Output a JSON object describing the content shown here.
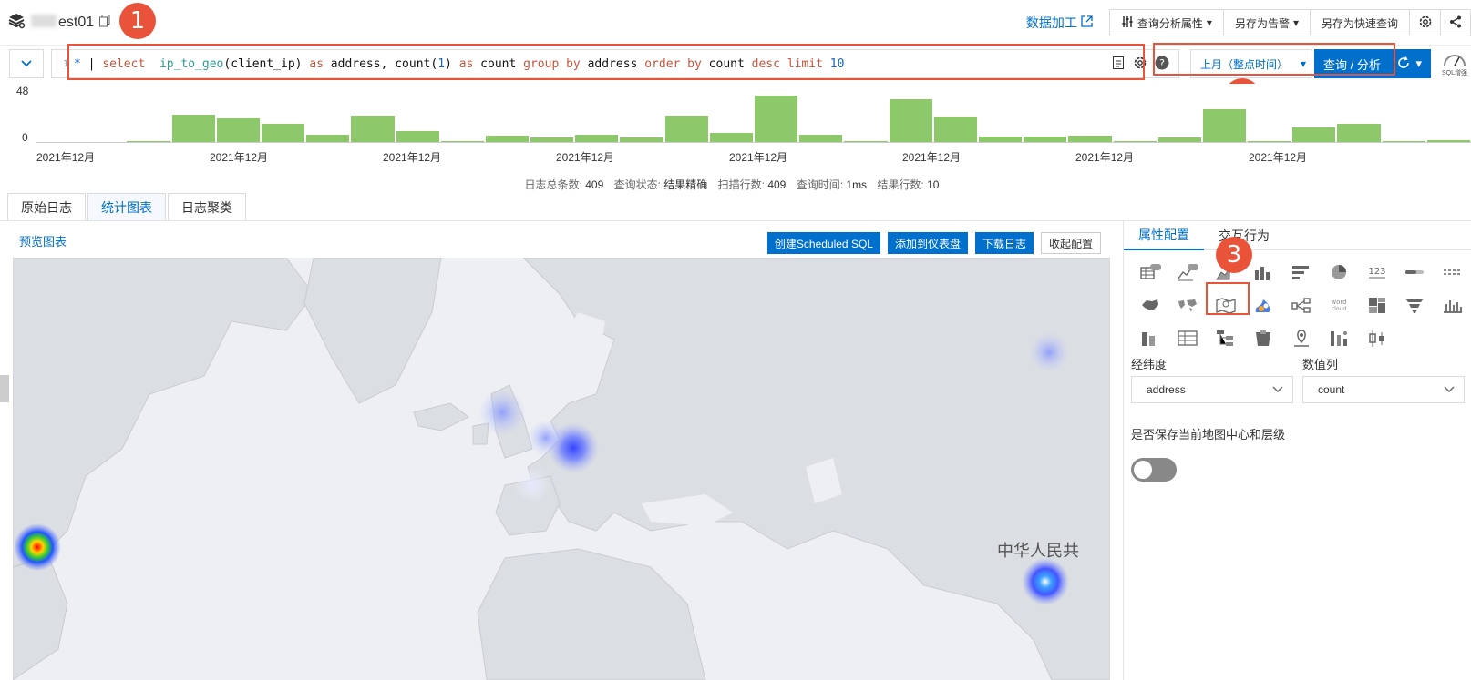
{
  "header": {
    "logstore_name": "est01",
    "data_processing_label": "数据加工",
    "buttons": [
      "查询分析属性",
      "另存为告警",
      "另存为快速查询"
    ]
  },
  "query": {
    "line_number": "1",
    "tokens": [
      {
        "t": "*",
        "c": "star"
      },
      {
        "t": " | ",
        "c": "plain"
      },
      {
        "t": "select",
        "c": "kw"
      },
      {
        "t": "  ",
        "c": "plain"
      },
      {
        "t": "ip_to_geo",
        "c": "fn"
      },
      {
        "t": "(client_ip) ",
        "c": "plain"
      },
      {
        "t": "as",
        "c": "kw"
      },
      {
        "t": " address, count(",
        "c": "plain"
      },
      {
        "t": "1",
        "c": "num"
      },
      {
        "t": ") ",
        "c": "plain"
      },
      {
        "t": "as",
        "c": "kw"
      },
      {
        "t": " count ",
        "c": "plain"
      },
      {
        "t": "group by",
        "c": "kw"
      },
      {
        "t": " address ",
        "c": "plain"
      },
      {
        "t": "order by",
        "c": "kw"
      },
      {
        "t": " count ",
        "c": "plain"
      },
      {
        "t": "desc limit",
        "c": "kw"
      },
      {
        "t": " ",
        "c": "plain"
      },
      {
        "t": "10",
        "c": "num"
      }
    ],
    "time_range": "上月（整点时间）",
    "run_label": "查询 / 分析",
    "sql_enhance_label": "SQL增强"
  },
  "annotations": [
    "1",
    "2",
    "3"
  ],
  "histogram": {
    "y_max": "48",
    "y_min": "0",
    "x_labels": [
      "2021年12月",
      "2021年12月",
      "2021年12月",
      "2021年12月",
      "2021年12月",
      "2021年12月",
      "2021年12月",
      "2021年12月"
    ],
    "values": [
      0,
      0,
      1,
      26,
      22,
      17,
      7,
      25,
      10,
      1,
      6,
      4,
      7,
      4,
      25,
      9,
      44,
      7,
      1,
      40,
      24,
      5,
      5,
      6,
      1,
      4,
      31,
      1,
      14,
      17,
      1,
      2
    ]
  },
  "stats": {
    "total_label": "日志总条数:",
    "total": "409",
    "status_label": "查询状态:",
    "status": "结果精确",
    "scanned_label": "扫描行数:",
    "scanned": "409",
    "time_label": "查询时间:",
    "time": "1ms",
    "rows_label": "结果行数:",
    "rows": "10"
  },
  "tabs": [
    "原始日志",
    "统计图表",
    "日志聚类"
  ],
  "left_pane": {
    "preview_title": "预览图表",
    "actions": [
      "创建Scheduled SQL",
      "添加到仪表盘",
      "下载日志",
      "收起配置"
    ],
    "map_label": "中华人民共"
  },
  "right_pane": {
    "tabs": [
      "属性配置",
      "交互行为"
    ],
    "chart_icons": [
      "table-pro",
      "line-pro",
      "area-pro",
      "bar",
      "horizontal-bar",
      "pie",
      "single-value",
      "progress",
      "flow",
      "china-map",
      "world-map",
      "amap",
      "heat-map",
      "sankey",
      "word-cloud",
      "treemap",
      "funnel",
      "histogram",
      "column-stack",
      "table",
      "tree",
      "rect-tree",
      "location",
      "tree-map",
      "candlestick"
    ],
    "lonlat_label": "经纬度",
    "value_col_label": "数值列",
    "lonlat_value": "address",
    "value_col_value": "count",
    "keep_center_label": "是否保存当前地图中心和层级"
  },
  "colors": {
    "accent": "#0070cc",
    "bar": "#8dc86b",
    "annotation": "#e8533a"
  }
}
